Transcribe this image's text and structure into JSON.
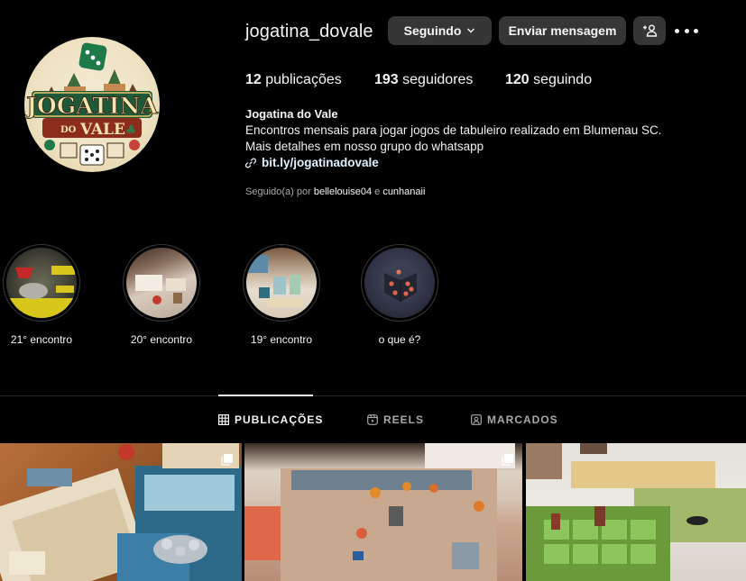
{
  "profile": {
    "username": "jogatina_dovale",
    "avatar_logo_text": "JOGATINA DO VALE",
    "following_button": "Seguindo",
    "message_button": "Enviar mensagem",
    "add_user_icon": "person-add-icon",
    "more_icon": "more-options-icon"
  },
  "stats": {
    "posts_count": "12",
    "posts_label": "publicações",
    "followers_count": "193",
    "followers_label": "seguidores",
    "following_count": "120",
    "following_label": "seguindo"
  },
  "bio": {
    "name": "Jogatina do Vale",
    "line1": "Encontros mensais para jogar jogos de tabuleiro realizado em Blumenau SC.",
    "line2": "Mais detalhes em nosso grupo do whatsapp",
    "link": "bit.ly/jogatinadovale"
  },
  "followed_by": {
    "prefix": "Seguido(a) por",
    "user1": "bellelouise04",
    "conj": "e",
    "user2": "cunhanaii"
  },
  "highlights": [
    {
      "label": "21° encontro"
    },
    {
      "label": "20° encontro"
    },
    {
      "label": "19° encontro"
    },
    {
      "label": "o que é?"
    }
  ],
  "tabs": [
    {
      "label": "PUBLICAÇÕES",
      "icon": "grid-icon",
      "active": true
    },
    {
      "label": "REELS",
      "icon": "reels-icon",
      "active": false
    },
    {
      "label": "MARCADOS",
      "icon": "tagged-icon",
      "active": false
    }
  ],
  "colors": {
    "background": "#000000",
    "button_bg": "#363636",
    "muted_text": "#a8a8a8",
    "link_text": "#e0f1ff"
  }
}
